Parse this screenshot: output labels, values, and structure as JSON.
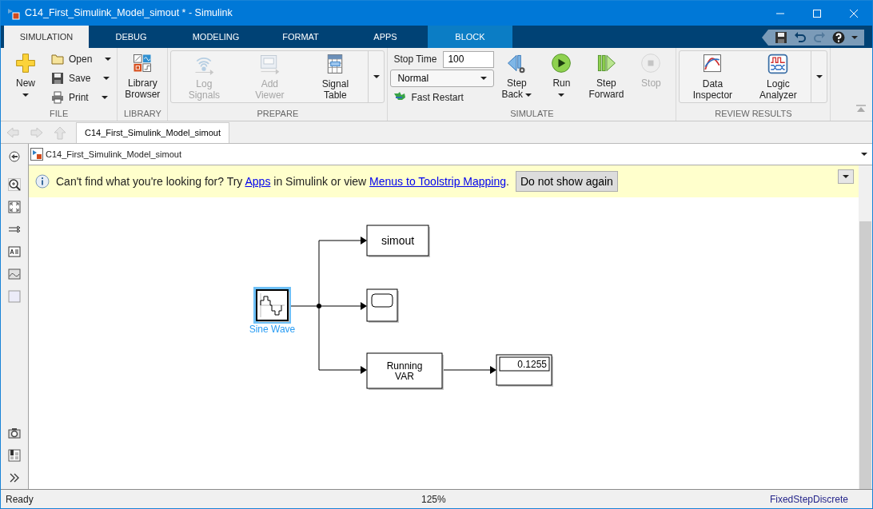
{
  "window": {
    "title": "C14_First_Simulink_Model_simout * - Simulink"
  },
  "ribbon_tabs": [
    {
      "label": "SIMULATION",
      "selected": true,
      "kind": "standard"
    },
    {
      "label": "DEBUG",
      "selected": false,
      "kind": "standard"
    },
    {
      "label": "MODELING",
      "selected": false,
      "kind": "standard"
    },
    {
      "label": "FORMAT",
      "selected": false,
      "kind": "standard"
    },
    {
      "label": "APPS",
      "selected": false,
      "kind": "standard"
    },
    {
      "label": "BLOCK",
      "selected": false,
      "kind": "contextual"
    }
  ],
  "quick_access": [
    {
      "kind": "save",
      "disabled": false
    },
    {
      "kind": "undo",
      "disabled": false
    },
    {
      "kind": "redo",
      "disabled": true
    },
    {
      "kind": "help",
      "disabled": false
    }
  ],
  "ribbon_groups": [
    {
      "title": "FILE",
      "gallery": false,
      "items": [
        {
          "kind": "large",
          "label": "New",
          "dropdown": true,
          "disabled": false
        },
        {
          "kind": "small",
          "label": "Open",
          "dropdown": true,
          "disabled": false
        },
        {
          "kind": "small",
          "label": "Save",
          "dropdown": true,
          "disabled": false
        },
        {
          "kind": "small",
          "label": "Print",
          "dropdown": true,
          "disabled": false
        }
      ]
    },
    {
      "title": "LIBRARY",
      "gallery": false,
      "items": [
        {
          "kind": "large",
          "label": "Library Browser",
          "dropdown": false,
          "disabled": false
        }
      ]
    },
    {
      "title": "PREPARE",
      "gallery": true,
      "items": [
        {
          "kind": "large",
          "label": "Log Signals",
          "dropdown": false,
          "disabled": true
        },
        {
          "kind": "large",
          "label": "Add Viewer",
          "dropdown": false,
          "disabled": true
        },
        {
          "kind": "large",
          "label": "Signal Table",
          "dropdown": false,
          "disabled": false
        }
      ]
    },
    {
      "title": "SIMULATE",
      "gallery": false,
      "items": [
        {
          "kind": "field",
          "label": "Stop Time",
          "value": "100"
        },
        {
          "kind": "select",
          "value": "Normal"
        },
        {
          "kind": "small",
          "label": "Fast Restart",
          "dropdown": false,
          "disabled": false
        },
        {
          "kind": "large",
          "label": "Step Back",
          "dropdown": true,
          "disabled": false
        },
        {
          "kind": "large",
          "label": "Run",
          "dropdown": true,
          "disabled": false
        },
        {
          "kind": "large",
          "label": "Step Forward",
          "dropdown": false,
          "disabled": false
        },
        {
          "kind": "large",
          "label": "Stop",
          "dropdown": false,
          "disabled": true
        }
      ]
    },
    {
      "title": "REVIEW RESULTS",
      "gallery": true,
      "items": [
        {
          "kind": "large",
          "label": "Data Inspector",
          "dropdown": false,
          "disabled": false
        },
        {
          "kind": "large",
          "label": "Logic Analyzer",
          "dropdown": false,
          "disabled": false
        }
      ]
    }
  ],
  "history": [
    {
      "kind": "back",
      "disabled": true
    },
    {
      "kind": "forward",
      "disabled": true
    },
    {
      "kind": "up",
      "disabled": true
    }
  ],
  "editor_tabs": [
    {
      "label": "C14_First_Simulink_Model_simout",
      "selected": true
    }
  ],
  "address": {
    "path": "C14_First_Simulink_Model_simout"
  },
  "banner": {
    "parts": [
      {
        "kind": "text",
        "text": "Can't find what you're looking for? Try "
      },
      {
        "kind": "link",
        "text": "Apps"
      },
      {
        "kind": "text",
        "text": " in Simulink or view "
      },
      {
        "kind": "link",
        "text": "Menus to Toolstrip Mapping"
      },
      {
        "kind": "text",
        "text": "."
      }
    ],
    "button": "Do not show again"
  },
  "diagram": {
    "blocks": [
      {
        "kind": "sine_wave",
        "label": "Sine Wave",
        "selected": true
      },
      {
        "kind": "to_workspace",
        "text": "simout",
        "selected": false
      },
      {
        "kind": "scope",
        "selected": false
      },
      {
        "kind": "running_var",
        "lines": [
          "Running",
          "VAR"
        ],
        "selected": false
      },
      {
        "kind": "display",
        "value": "0.1255",
        "selected": false
      }
    ]
  },
  "status_bar": {
    "left": "Ready",
    "center": "125%",
    "right": "FixedStepDiscrete"
  }
}
